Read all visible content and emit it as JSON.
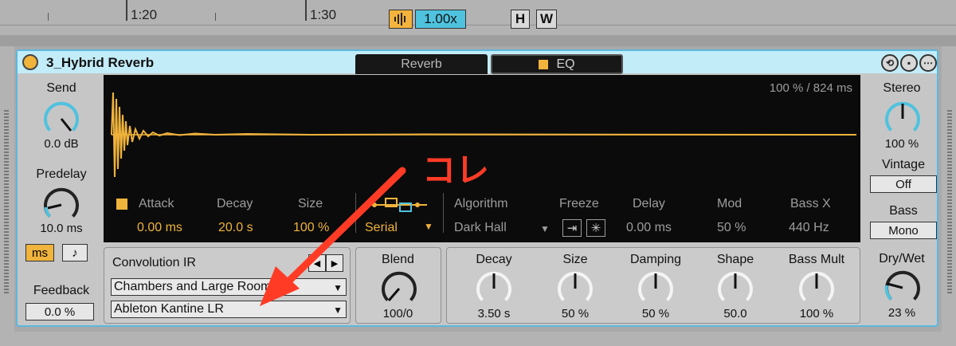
{
  "timeline": {
    "marker_1": "1:20",
    "marker_2": "1:30",
    "zoom_value": "1.00x",
    "btn_h": "H",
    "btn_w": "W"
  },
  "device": {
    "title": "3_Hybrid Reverb",
    "tabs": {
      "reverb": "Reverb",
      "eq": "EQ"
    },
    "left": {
      "send_label": "Send",
      "send_value": "0.0 dB",
      "predelay_label": "Predelay",
      "predelay_value": "10.0 ms",
      "ms_button": "ms",
      "note_button": "♪",
      "feedback_label": "Feedback",
      "feedback_value": "0.0 %"
    },
    "display": {
      "info": "100 %  / 824 ms",
      "attack_label": "Attack",
      "attack_value": "0.00 ms",
      "decay_label": "Decay",
      "decay_value": "20.0 s",
      "size_label": "Size",
      "size_value": "100 %",
      "routing_value": "Serial",
      "algorithm_label": "Algorithm",
      "algorithm_value": "Dark Hall",
      "freeze_label": "Freeze",
      "delay_label": "Delay",
      "delay_value": "0.00 ms",
      "mod_label": "Mod",
      "mod_value": "50 %",
      "bassx_label": "Bass X",
      "bassx_value": "440 Hz"
    },
    "right": {
      "stereo_label": "Stereo",
      "stereo_value": "100 %",
      "vintage_label": "Vintage",
      "vintage_value": "Off",
      "bass_label": "Bass",
      "bass_value": "Mono",
      "drywet_label": "Dry/Wet",
      "drywet_value": "23 %"
    },
    "convolution": {
      "label": "Convolution IR",
      "category": "Chambers and Large Rooms",
      "ir": "Ableton Kantine LR"
    },
    "blend": {
      "label": "Blend",
      "value": "100/0"
    },
    "algo_params": {
      "decay_label": "Decay",
      "decay_value": "3.50 s",
      "size_label": "Size",
      "size_value": "50 %",
      "damping_label": "Damping",
      "damping_value": "50 %",
      "shape_label": "Shape",
      "shape_value": "50.0",
      "bassmult_label": "Bass Mult",
      "bassmult_value": "100 %"
    }
  },
  "annotation": {
    "text": "コレ"
  },
  "colors": {
    "accent_orange": "#f0b33c",
    "knob_blue": "#4fc2de",
    "title_bg": "#c2ecf8",
    "annotation_red": "#ff3b26"
  }
}
